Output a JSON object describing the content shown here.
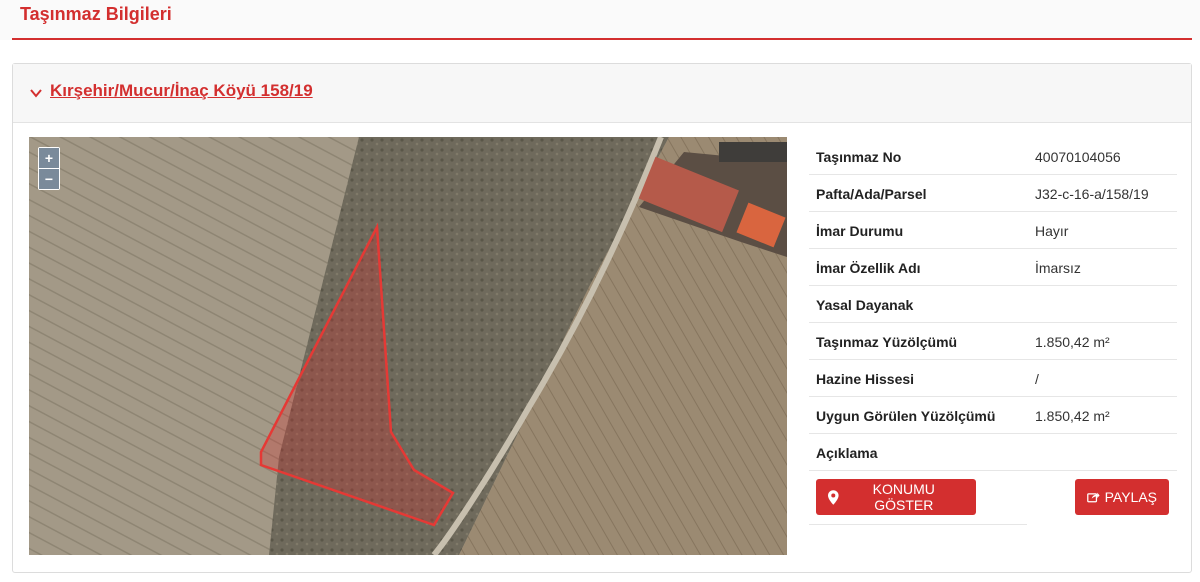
{
  "page": {
    "title": "Taşınmaz Bilgileri"
  },
  "parcel": {
    "link_text": "Kırşehir/Mucur/İnaç Köyü 158/19"
  },
  "map": {
    "zoom_in": "+",
    "zoom_out": "−"
  },
  "info": {
    "rows": [
      {
        "label": "Taşınmaz No",
        "value": "40070104056"
      },
      {
        "label": "Pafta/Ada/Parsel",
        "value": "J32-c-16-a/158/19"
      },
      {
        "label": "İmar Durumu",
        "value": "Hayır"
      },
      {
        "label": "İmar Özellik Adı",
        "value": "İmarsız"
      },
      {
        "label": "Yasal Dayanak",
        "value": ""
      },
      {
        "label": "Taşınmaz Yüzölçümü",
        "value": "1.850,42 m²"
      },
      {
        "label": "Hazine Hissesi",
        "value": "/"
      },
      {
        "label": "Uygun Görülen Yüzölçümü",
        "value": "1.850,42 m²"
      },
      {
        "label": "Açıklama",
        "value": ""
      }
    ]
  },
  "actions": {
    "locate_label": "KONUMU GÖSTER",
    "share_label": "PAYLAŞ"
  },
  "colors": {
    "accent": "#d32f2f",
    "parcel_outline": "#e53935"
  },
  "icons": {
    "expand": "chevron-down-icon",
    "locate": "map-marker-icon",
    "share": "share-icon"
  }
}
